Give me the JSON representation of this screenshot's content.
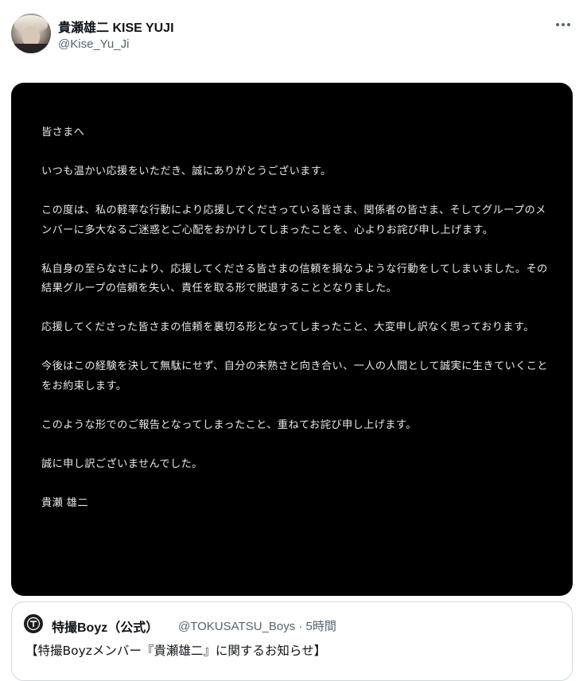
{
  "tweet": {
    "display_name": "貴瀬雄二 KISE YUJI",
    "handle": "@Kise_Yu_Ji",
    "avatar_icon": "profile-avatar",
    "more_icon": "more-horizontal-icon"
  },
  "media": {
    "letter": [
      "皆さまへ",
      "いつも温かい応援をいただき、誠にありがとうございます。",
      "この度は、私の軽率な行動により応援してくださっている皆さま、関係者の皆さま、そしてグループのメンバーに多大なるご迷惑とご心配をおかけしてしまったことを、心よりお詫び申し上げます。",
      "私自身の至らなさにより、応援してくださる皆さまの信頼を損なうような行動をしてしまいました。その結果グループの信頼を失い、責任を取る形で脱退することとなりました。",
      "応援してくださった皆さまの信頼を裏切る形となってしまったこと、大変申し訳なく思っております。",
      "今後はこの経験を決して無駄にせず、自分の未熟さと向き合い、一人の人間として誠実に生きていくことをお約束します。",
      "このような形でのご報告となってしまったこと、重ねてお詫び申し上げます。",
      "誠に申し訳ございませんでした。",
      "貴瀬 雄二"
    ]
  },
  "quoted": {
    "display_name": "特撮Boyz（公式）",
    "meta": "@TOKUSATSU_Boys · 5時間",
    "text": "【特撮Boyzメンバー『貴瀬雄二』に関するお知らせ】"
  },
  "colors": {
    "text_primary": "#0f1419",
    "text_secondary": "#536471",
    "border": "#cfd9de",
    "media_background": "#000000"
  }
}
